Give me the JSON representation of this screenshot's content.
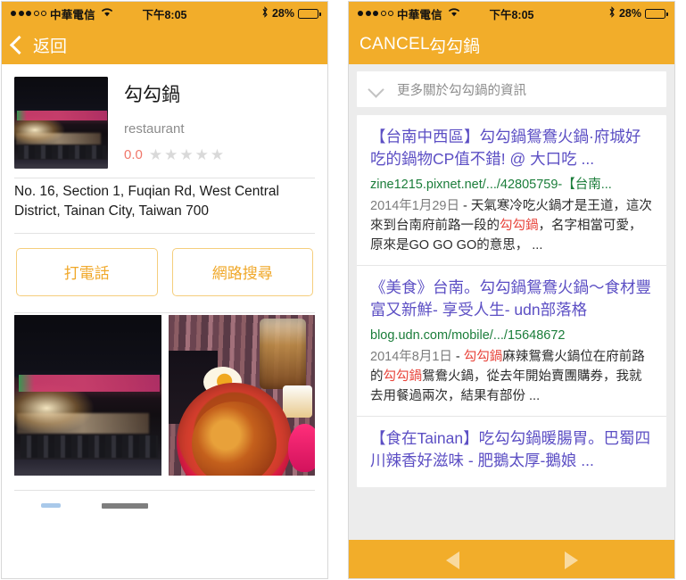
{
  "status_bar": {
    "carrier": "中華電信",
    "signal_dots_filled": 3,
    "signal_dots_total": 5,
    "wifi_icon": "wifi-icon",
    "time": "下午8:05",
    "bluetooth_icon": "bluetooth-icon",
    "battery_percent": "28%",
    "battery_level": 28
  },
  "colors": {
    "accent_orange": "#F2AD2A",
    "button_border": "#F5CE7D",
    "button_text": "#F0A82A",
    "link_purple": "#5C4FC4",
    "url_green": "#1B7D3A",
    "highlight_red": "#E8453C",
    "rating_red": "#F0776A",
    "star_gray": "#D9D9D9",
    "page_bg_gray": "#ECECEC"
  },
  "left_panel": {
    "nav": {
      "back_label": "返回",
      "back_icon": "chevron-left-icon"
    },
    "business": {
      "thumbnail_alt": "restaurant-storefront-photo",
      "name": "勾勾鍋",
      "category": "restaurant",
      "rating_value": "0.0",
      "stars_total": 5,
      "stars_filled": 0,
      "address": "No. 16, Section 1, Fuqian Rd, West Central District, Tainan City, Taiwan 700"
    },
    "actions": [
      {
        "label": "打電話",
        "name": "call-button"
      },
      {
        "label": "網路搜尋",
        "name": "web-search-button"
      }
    ],
    "photos": [
      {
        "alt": "storefront-night-photo"
      },
      {
        "alt": "hotpot-dish-photo"
      }
    ]
  },
  "right_panel": {
    "nav": {
      "cancel_label": "CANCEL",
      "title": "勾勾鍋"
    },
    "more_info": {
      "icon": "chevron-down-icon",
      "label": "更多關於勾勾鍋的資訊"
    },
    "results": [
      {
        "title": "【台南中西區】勾勾鍋鴛鴦火鍋·府城好吃的鍋物CP值不錯! @ 大口吃 ...",
        "url": "zine1215.pixnet.net/.../42805759-【台南...",
        "date": "2014年1月29日",
        "snippet_pre": " - 天氣寒冷吃火鍋才是王道，這次來到台南府前路一段的",
        "snippet_highlight": "勾勾鍋",
        "snippet_post": "，名字相當可愛，原來是GO GO GO的意思， ..."
      },
      {
        "title": "《美食》台南。勾勾鍋鴛鴦火鍋～食材豐富又新鮮- 享受人生- udn部落格",
        "url": "blog.udn.com/mobile/.../15648672",
        "date": "2014年8月1日",
        "snippet_pre": " - ",
        "snippet_highlight": "勾勾鍋",
        "snippet_mid": "麻辣鴛鴦火鍋位在府前路的",
        "snippet_highlight2": "勾勾鍋",
        "snippet_post": "鴛鴦火鍋，從去年開始賣團購券，我就去用餐過兩次，結果有部份 ..."
      },
      {
        "title": "【食在Tainan】吃勾勾鍋暖腸胃。巴蜀四川辣香好滋味 - 肥鵝太厚-鵝娘 ...",
        "url": "",
        "date": "",
        "snippet_pre": "",
        "snippet_highlight": "",
        "snippet_post": ""
      }
    ],
    "bottom_bar": {
      "back_icon": "triangle-left-icon",
      "forward_icon": "triangle-right-icon"
    }
  }
}
